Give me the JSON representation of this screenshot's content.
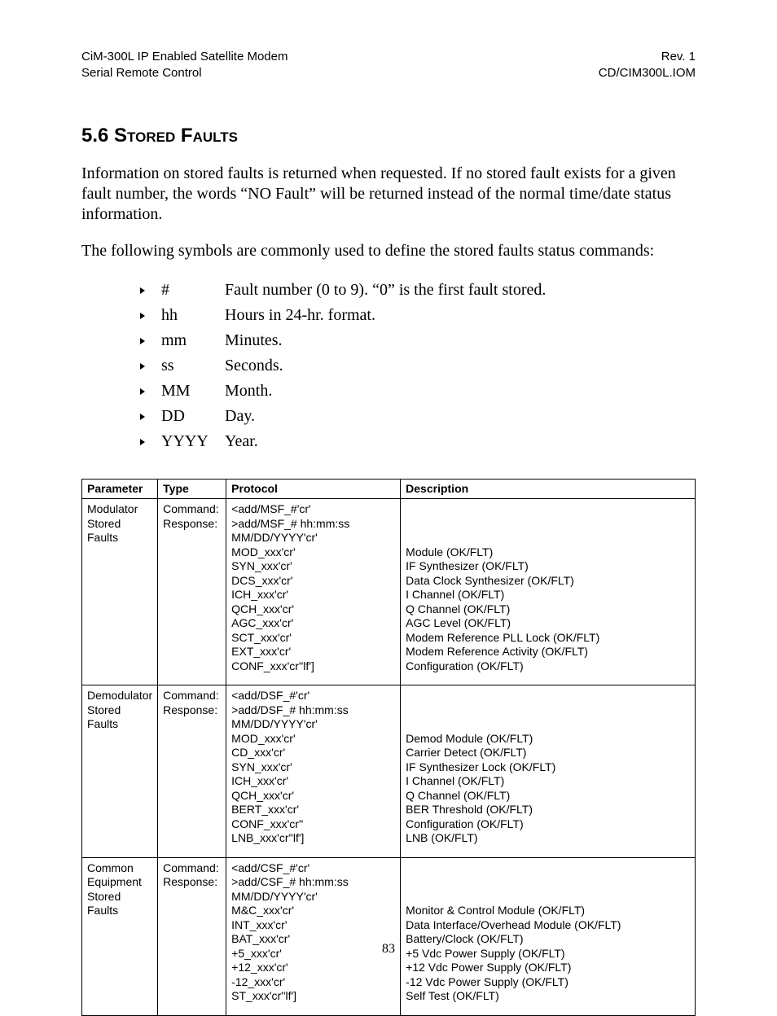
{
  "header": {
    "left1": "CiM-300L IP Enabled Satellite Modem",
    "right1": "Rev. 1",
    "left2": "Serial Remote Control",
    "right2": "CD/CIM300L.IOM"
  },
  "section": {
    "number": "5.6",
    "title": "Stored Faults"
  },
  "paragraphs": {
    "p1": "Information on stored faults is returned when requested. If no stored fault exists for a given fault number, the words “NO Fault” will be returned instead of the normal time/date status information.",
    "p2": "The following symbols are commonly used to define the stored faults status commands:"
  },
  "symbols": [
    {
      "sym": "#",
      "def": "Fault number (0 to 9). “0” is the first fault stored."
    },
    {
      "sym": "hh",
      "def": "Hours in 24-hr. format."
    },
    {
      "sym": "mm",
      "def": "Minutes."
    },
    {
      "sym": "ss",
      "def": "Seconds."
    },
    {
      "sym": "MM",
      "def": "Month."
    },
    {
      "sym": "DD",
      "def": "Day."
    },
    {
      "sym": "YYYY",
      "def": "Year."
    }
  ],
  "table": {
    "headers": {
      "param": "Parameter",
      "type": "Type",
      "proto": "Protocol",
      "desc": "Description"
    },
    "rows": [
      {
        "param": "Modulator Stored Faults",
        "type": [
          "Command:",
          "Response:"
        ],
        "proto": [
          "<add/MSF_#'cr'",
          ">add/MSF_# hh:mm:ss",
          "MM/DD/YYYY'cr'",
          "MOD_xxx'cr'",
          "SYN_xxx'cr'",
          "DCS_xxx'cr'",
          "ICH_xxx'cr'",
          "QCH_xxx'cr'",
          "AGC_xxx'cr'",
          "SCT_xxx'cr'",
          "EXT_xxx'cr'",
          "CONF_xxx'cr''lf']"
        ],
        "desc_lead_blank": 3,
        "desc": [
          "Module (OK/FLT)",
          "IF Synthesizer (OK/FLT)",
          "Data Clock Synthesizer (OK/FLT)",
          "I Channel (OK/FLT)",
          "Q Channel (OK/FLT)",
          "AGC Level (OK/FLT)",
          "Modem Reference PLL Lock (OK/FLT)",
          "Modem Reference Activity (OK/FLT)",
          "Configuration (OK/FLT)"
        ]
      },
      {
        "param": "Demodulator Stored Faults",
        "type": [
          "Command:",
          "Response:"
        ],
        "proto": [
          "<add/DSF_#'cr'",
          ">add/DSF_# hh:mm:ss",
          "MM/DD/YYYY'cr'",
          "MOD_xxx'cr'",
          "CD_xxx'cr'",
          "SYN_xxx'cr'",
          "ICH_xxx'cr'",
          "QCH_xxx'cr'",
          "BERT_xxx'cr'",
          "CONF_xxx'cr''",
          "LNB_xxx'cr''lf']"
        ],
        "desc_lead_blank": 3,
        "desc": [
          "Demod Module (OK/FLT)",
          "Carrier Detect (OK/FLT)",
          "IF Synthesizer Lock (OK/FLT)",
          "I Channel (OK/FLT)",
          "Q Channel (OK/FLT)",
          "BER Threshold (OK/FLT)",
          "Configuration (OK/FLT)",
          "LNB (OK/FLT)"
        ]
      },
      {
        "param": "Common Equipment Stored Faults",
        "type": [
          "Command:",
          "Response:"
        ],
        "proto": [
          "<add/CSF_#'cr'",
          ">add/CSF_# hh:mm:ss",
          "MM/DD/YYYY'cr'",
          "M&C_xxx'cr'",
          "INT_xxx'cr'",
          "BAT_xxx'cr'",
          "+5_xxx'cr'",
          "+12_xxx'cr'",
          "-12_xxx'cr'",
          "ST_xxx'cr''lf']"
        ],
        "desc_lead_blank": 3,
        "desc": [
          "Monitor & Control Module (OK/FLT)",
          "Data Interface/Overhead Module (OK/FLT)",
          "Battery/Clock (OK/FLT)",
          "+5 Vdc Power Supply (OK/FLT)",
          "+12 Vdc Power Supply (OK/FLT)",
          "-12 Vdc Power Supply (OK/FLT)",
          "Self Test (OK/FLT)"
        ]
      }
    ]
  },
  "page_number": "83"
}
